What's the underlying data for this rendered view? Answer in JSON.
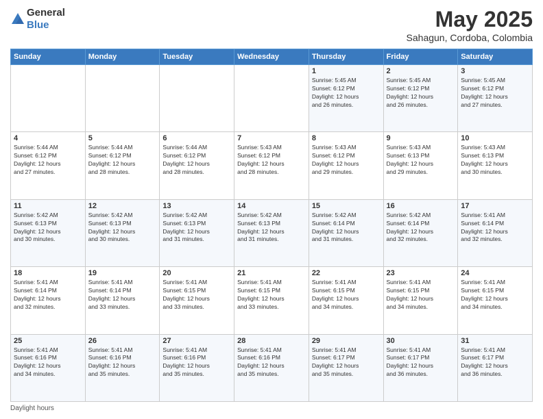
{
  "header": {
    "logo_general": "General",
    "logo_blue": "Blue",
    "month_title": "May 2025",
    "location": "Sahagun, Cordoba, Colombia"
  },
  "days_of_week": [
    "Sunday",
    "Monday",
    "Tuesday",
    "Wednesday",
    "Thursday",
    "Friday",
    "Saturday"
  ],
  "weeks": [
    [
      {
        "day": "",
        "text": ""
      },
      {
        "day": "",
        "text": ""
      },
      {
        "day": "",
        "text": ""
      },
      {
        "day": "",
        "text": ""
      },
      {
        "day": "1",
        "text": "Sunrise: 5:45 AM\nSunset: 6:12 PM\nDaylight: 12 hours\nand 26 minutes."
      },
      {
        "day": "2",
        "text": "Sunrise: 5:45 AM\nSunset: 6:12 PM\nDaylight: 12 hours\nand 26 minutes."
      },
      {
        "day": "3",
        "text": "Sunrise: 5:45 AM\nSunset: 6:12 PM\nDaylight: 12 hours\nand 27 minutes."
      }
    ],
    [
      {
        "day": "4",
        "text": "Sunrise: 5:44 AM\nSunset: 6:12 PM\nDaylight: 12 hours\nand 27 minutes."
      },
      {
        "day": "5",
        "text": "Sunrise: 5:44 AM\nSunset: 6:12 PM\nDaylight: 12 hours\nand 28 minutes."
      },
      {
        "day": "6",
        "text": "Sunrise: 5:44 AM\nSunset: 6:12 PM\nDaylight: 12 hours\nand 28 minutes."
      },
      {
        "day": "7",
        "text": "Sunrise: 5:43 AM\nSunset: 6:12 PM\nDaylight: 12 hours\nand 28 minutes."
      },
      {
        "day": "8",
        "text": "Sunrise: 5:43 AM\nSunset: 6:12 PM\nDaylight: 12 hours\nand 29 minutes."
      },
      {
        "day": "9",
        "text": "Sunrise: 5:43 AM\nSunset: 6:13 PM\nDaylight: 12 hours\nand 29 minutes."
      },
      {
        "day": "10",
        "text": "Sunrise: 5:43 AM\nSunset: 6:13 PM\nDaylight: 12 hours\nand 30 minutes."
      }
    ],
    [
      {
        "day": "11",
        "text": "Sunrise: 5:42 AM\nSunset: 6:13 PM\nDaylight: 12 hours\nand 30 minutes."
      },
      {
        "day": "12",
        "text": "Sunrise: 5:42 AM\nSunset: 6:13 PM\nDaylight: 12 hours\nand 30 minutes."
      },
      {
        "day": "13",
        "text": "Sunrise: 5:42 AM\nSunset: 6:13 PM\nDaylight: 12 hours\nand 31 minutes."
      },
      {
        "day": "14",
        "text": "Sunrise: 5:42 AM\nSunset: 6:13 PM\nDaylight: 12 hours\nand 31 minutes."
      },
      {
        "day": "15",
        "text": "Sunrise: 5:42 AM\nSunset: 6:14 PM\nDaylight: 12 hours\nand 31 minutes."
      },
      {
        "day": "16",
        "text": "Sunrise: 5:42 AM\nSunset: 6:14 PM\nDaylight: 12 hours\nand 32 minutes."
      },
      {
        "day": "17",
        "text": "Sunrise: 5:41 AM\nSunset: 6:14 PM\nDaylight: 12 hours\nand 32 minutes."
      }
    ],
    [
      {
        "day": "18",
        "text": "Sunrise: 5:41 AM\nSunset: 6:14 PM\nDaylight: 12 hours\nand 32 minutes."
      },
      {
        "day": "19",
        "text": "Sunrise: 5:41 AM\nSunset: 6:14 PM\nDaylight: 12 hours\nand 33 minutes."
      },
      {
        "day": "20",
        "text": "Sunrise: 5:41 AM\nSunset: 6:15 PM\nDaylight: 12 hours\nand 33 minutes."
      },
      {
        "day": "21",
        "text": "Sunrise: 5:41 AM\nSunset: 6:15 PM\nDaylight: 12 hours\nand 33 minutes."
      },
      {
        "day": "22",
        "text": "Sunrise: 5:41 AM\nSunset: 6:15 PM\nDaylight: 12 hours\nand 34 minutes."
      },
      {
        "day": "23",
        "text": "Sunrise: 5:41 AM\nSunset: 6:15 PM\nDaylight: 12 hours\nand 34 minutes."
      },
      {
        "day": "24",
        "text": "Sunrise: 5:41 AM\nSunset: 6:15 PM\nDaylight: 12 hours\nand 34 minutes."
      }
    ],
    [
      {
        "day": "25",
        "text": "Sunrise: 5:41 AM\nSunset: 6:16 PM\nDaylight: 12 hours\nand 34 minutes."
      },
      {
        "day": "26",
        "text": "Sunrise: 5:41 AM\nSunset: 6:16 PM\nDaylight: 12 hours\nand 35 minutes."
      },
      {
        "day": "27",
        "text": "Sunrise: 5:41 AM\nSunset: 6:16 PM\nDaylight: 12 hours\nand 35 minutes."
      },
      {
        "day": "28",
        "text": "Sunrise: 5:41 AM\nSunset: 6:16 PM\nDaylight: 12 hours\nand 35 minutes."
      },
      {
        "day": "29",
        "text": "Sunrise: 5:41 AM\nSunset: 6:17 PM\nDaylight: 12 hours\nand 35 minutes."
      },
      {
        "day": "30",
        "text": "Sunrise: 5:41 AM\nSunset: 6:17 PM\nDaylight: 12 hours\nand 36 minutes."
      },
      {
        "day": "31",
        "text": "Sunrise: 5:41 AM\nSunset: 6:17 PM\nDaylight: 12 hours\nand 36 minutes."
      }
    ]
  ],
  "footer": {
    "note": "Daylight hours"
  }
}
